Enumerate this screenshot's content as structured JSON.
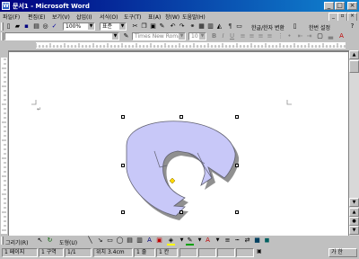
{
  "window": {
    "title": "문서1 - Microsoft Word",
    "app_icon": "W",
    "minimize": "_",
    "maximize": "□",
    "close": "×"
  },
  "menubar": {
    "items": [
      "파일(F)",
      "편집(E)",
      "보기(V)",
      "삽입(I)",
      "서식(O)",
      "도구(T)",
      "표(A)",
      "창(W)",
      "도움말(H)"
    ]
  },
  "standard_toolbar": {
    "zoom": "100%",
    "style": "표준",
    "hanja_label": "한글/한자 변환",
    "right_label": "한번 설정"
  },
  "formatting_toolbar": {
    "font_name": "Times New Roman",
    "font_size": "10"
  },
  "drawing_toolbar": {
    "draw_label": "그리기(R)",
    "autoshapes_label": "도형(U)"
  },
  "statusbar": {
    "page": "1 페이지",
    "section": "1 구역",
    "pages": "1/1",
    "position": "위치 3.4cm",
    "line": "1 줄",
    "column": "1 칸",
    "ime": "가 한"
  },
  "document": {
    "paragraph_mark": "↵"
  }
}
